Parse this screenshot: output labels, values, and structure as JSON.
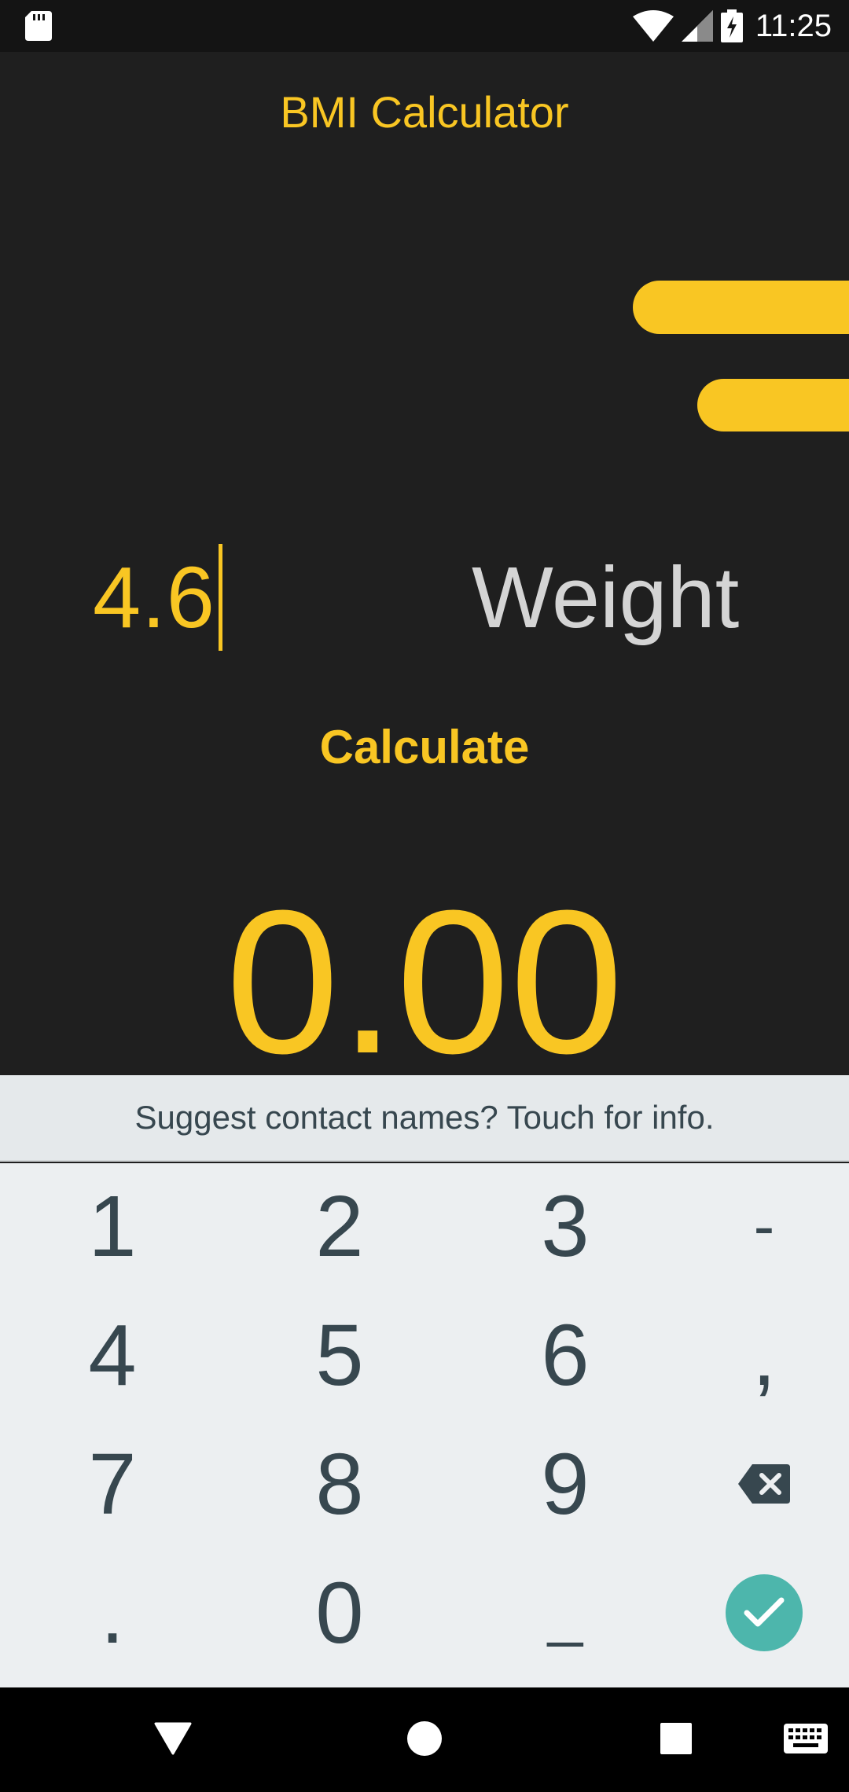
{
  "status_bar": {
    "time": "11:25",
    "icons": [
      "sd-card-icon",
      "wifi-icon",
      "signal-icon",
      "battery-charging-icon"
    ]
  },
  "app": {
    "title": "BMI Calculator"
  },
  "inputs": {
    "height_value": "4.6",
    "weight_placeholder": "Weight"
  },
  "calculate_label": "Calculate",
  "result_value": "0.00",
  "keyboard": {
    "suggestion": "Suggest contact names? Touch for info.",
    "keys": {
      "k1": "1",
      "k2": "2",
      "k3": "3",
      "dash": "-",
      "k4": "4",
      "k5": "5",
      "k6": "6",
      "comma": ",",
      "k7": "7",
      "k8": "8",
      "k9": "9",
      "dot": ".",
      "k0": "0",
      "space": "_"
    }
  },
  "colors": {
    "accent": "#f9c623",
    "background": "#1f1f1f",
    "keyboard": "#eceff1",
    "enter": "#4db6ac"
  }
}
